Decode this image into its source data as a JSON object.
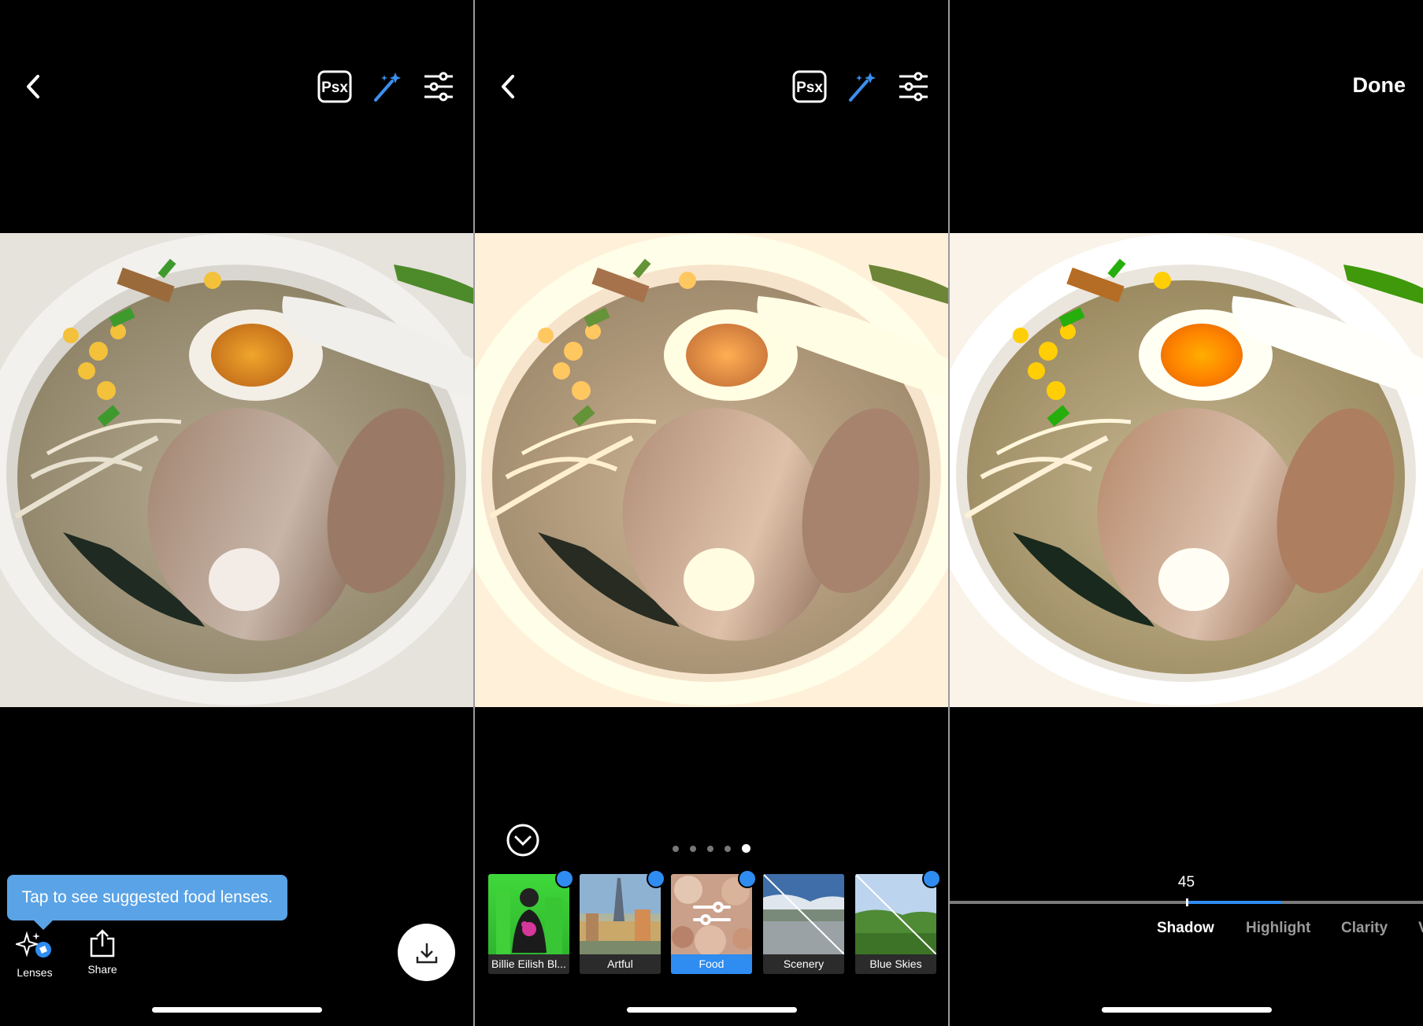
{
  "panel1": {
    "tooltip": "Tap to see suggested food lenses.",
    "bottom_bar": {
      "lenses_label": "Lenses",
      "share_label": "Share"
    }
  },
  "panel2": {
    "page_dots": {
      "count": 5,
      "active": 5
    },
    "lenses": [
      {
        "label": "Billie Eilish Bl...",
        "badge": "download"
      },
      {
        "label": "Artful",
        "badge": "download"
      },
      {
        "label": "Food",
        "badge": "suggested",
        "selected": true
      },
      {
        "label": "Scenery",
        "badge": ""
      },
      {
        "label": "Blue Skies",
        "badge": "download"
      }
    ]
  },
  "panel3": {
    "done_label": "Done",
    "slider_value": "45",
    "slider_level": 0.45,
    "tabs": [
      "Shadow",
      "Highlight",
      "Clarity",
      "V"
    ]
  },
  "colors": {
    "accent": "#2f8cf0",
    "magic_wand": "#3b8ff0",
    "tooltip": "#5aa3e6",
    "background": "#000000"
  },
  "icons": [
    "back-chevron-icon",
    "psx-icon",
    "magic-wand-icon",
    "sliders-icon",
    "lenses-icon",
    "share-icon",
    "download-icon",
    "collapse-chevron-icon",
    "filter-sliders-icon"
  ]
}
